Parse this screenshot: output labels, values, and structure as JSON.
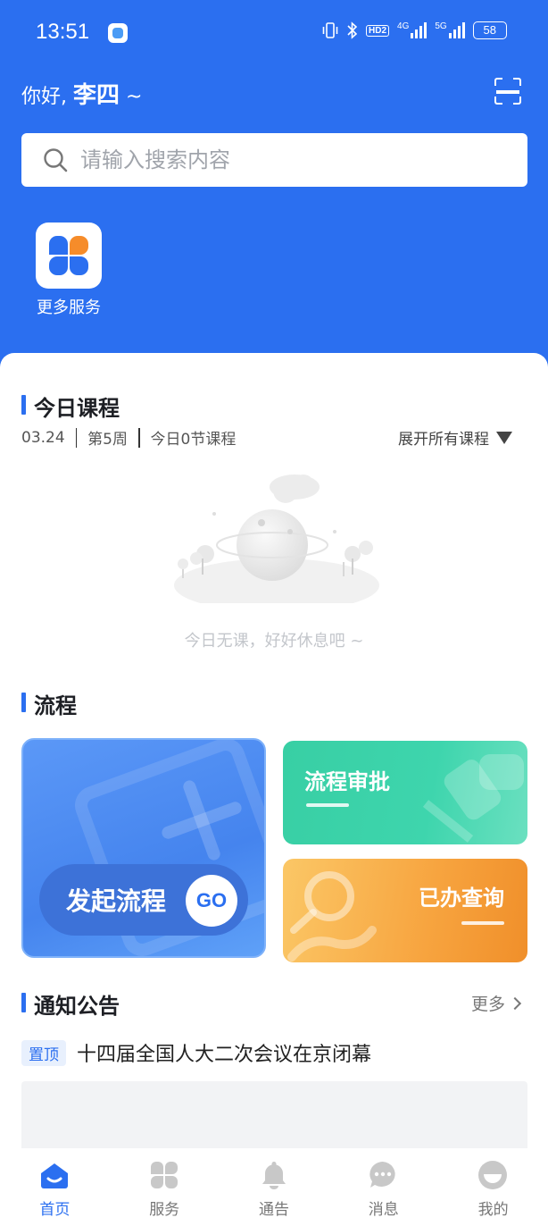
{
  "status_bar": {
    "time": "13:51",
    "hd_badge": "HD2",
    "net1": "4G",
    "net2": "5G",
    "battery": "58"
  },
  "header": {
    "greeting": "你好,",
    "user_name": "李四",
    "greeting_suffix": "~",
    "scan_icon": "scan-icon"
  },
  "search": {
    "placeholder": "请输入搜索内容"
  },
  "quick_services": [
    {
      "label": "更多服务",
      "icon": "clover-grid-icon",
      "colors": [
        "#2b6ff0",
        "#f68c2a",
        "#2b6ff0",
        "#2b6ff0"
      ]
    }
  ],
  "today_courses": {
    "title": "今日课程",
    "date": "03.24",
    "week": "第5周",
    "count_text": "今日0节课程",
    "expand_label": "展开所有课程",
    "empty_text": "今日无课，好好休息吧 ~"
  },
  "process": {
    "title": "流程",
    "start_label": "发起流程",
    "go_label": "GO",
    "approve_label": "流程审批",
    "query_label": "已办查询"
  },
  "notices": {
    "title": "通知公告",
    "more_label": "更多",
    "items": [
      {
        "badge": "置顶",
        "title": "十四届全国人大二次会议在京闭幕"
      }
    ]
  },
  "tabbar": {
    "items": [
      {
        "label": "首页",
        "icon": "home-icon",
        "active": true
      },
      {
        "label": "服务",
        "icon": "services-grid-icon",
        "active": false
      },
      {
        "label": "通告",
        "icon": "bell-icon",
        "active": false
      },
      {
        "label": "消息",
        "icon": "message-icon",
        "active": false
      },
      {
        "label": "我的",
        "icon": "profile-icon",
        "active": false
      }
    ]
  },
  "colors": {
    "primary": "#2b6ff0",
    "approve_green": "#3ed5ad",
    "query_orange": "#f7a43f"
  }
}
